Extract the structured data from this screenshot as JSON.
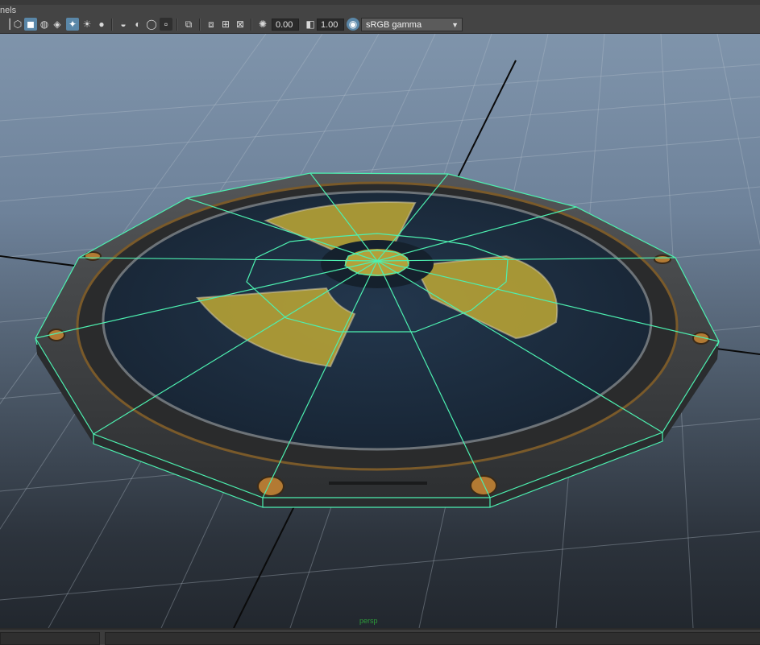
{
  "menu": {
    "label": "nels"
  },
  "toolbar": {
    "icons": [
      "wireframe-icon",
      "smooth-shade-icon",
      "shaded-icon",
      "wireframe-on-shaded-icon",
      "textured-icon",
      "use-lights-icon",
      "shadows-icon",
      "screen-space-ao-icon",
      "motion-blur-icon",
      "multisample-aa-icon",
      "depth-of-field-icon",
      "isolate-select-icon",
      "xray-icon",
      "xray-joints-icon",
      "grid-icon",
      "camera-gate-icon",
      "exposure-icon",
      "gamma-icon",
      "color-management-icon"
    ],
    "exposure_value": "0.00",
    "gamma_value": "1.00",
    "color_space": "sRGB gamma"
  },
  "viewport": {
    "camera_label": "persp"
  },
  "colors": {
    "wireframe": "#4df0b0",
    "decal": "#c8b23a",
    "panel": "#1f3246",
    "rim": "#3a3c3e"
  }
}
